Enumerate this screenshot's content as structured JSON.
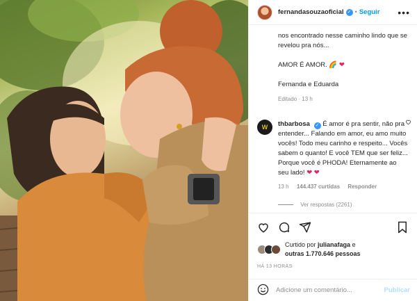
{
  "post": {
    "username": "fernandasouzaoficial",
    "separator": "•",
    "follow_label": "Seguir",
    "more_label": "•••",
    "verified_glyph": "✓"
  },
  "caption": {
    "line1": "nos encontrado nesse caminho lindo que se revelou pra nós...",
    "line2": "AMOR É AMOR.",
    "line2_emoji": "🌈",
    "line2_heart": "❤",
    "line3": "Fernanda e Eduarda",
    "edited": "Editado · 13 h"
  },
  "comment": {
    "user": "thbarbosa",
    "text": "É amor é pra sentir, não pra entender... Falando em amor, eu amo muito vocês! Todo meu carinho e respeito... Vocês sabem o quanto! E você TEM que ser feliz... Porque você é PHODA! Eternamente ao seu lado!",
    "hearts": "❤ ❤",
    "time": "13 h",
    "likes": "144.437 curtidas",
    "reply_label": "Responder",
    "view_replies": "Ver respostas (2261)",
    "like_icon": "heart-outline-icon",
    "avatar_glyph": "W"
  },
  "likes": {
    "liked_by_prefix": "Curtido por",
    "liked_by_user": "julianafaga",
    "and": "e",
    "others": "outras 1.770.646 pessoas"
  },
  "timestamp": "HÁ 13 HORAS",
  "add_comment": {
    "placeholder": "Adicione um comentário...",
    "publish_label": "Publicar"
  },
  "colors": {
    "accent": "#0095f6",
    "verified": "#3897f0",
    "heart": "#e0245e",
    "muted": "#8e8e8e"
  }
}
